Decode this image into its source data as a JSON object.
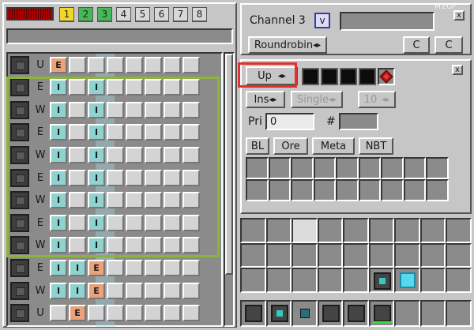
{
  "channels": [
    "1",
    "2",
    "3",
    "4",
    "5",
    "6",
    "7",
    "8"
  ],
  "channel_panel": {
    "label": "Channel 3",
    "checkbox_mark": "v",
    "name_value": "",
    "close": "x",
    "mode_button": "Roundrobin",
    "mode_arrow": "◂▸",
    "c_button_1": "C",
    "c_button_2": "C"
  },
  "settings_panel": {
    "close": "x",
    "direction_button": "Up",
    "ins_button": "Ins",
    "single_button": "Single",
    "count_button": "10",
    "arrow": "◂▸",
    "pri_label": "Pri",
    "pri_value": "0",
    "hash_label": "#",
    "hash_value": "",
    "filters": [
      "BL",
      "Ore",
      "Meta",
      "NBT"
    ]
  },
  "connections": [
    {
      "side": "U",
      "cells": [
        "E",
        "",
        "",
        "",
        "",
        "",
        "",
        ""
      ]
    },
    {
      "side": "E",
      "cells": [
        "I",
        "",
        "I",
        "",
        "",
        "",
        "",
        ""
      ]
    },
    {
      "side": "W",
      "cells": [
        "I",
        "",
        "I",
        "",
        "",
        "",
        "",
        ""
      ]
    },
    {
      "side": "E",
      "cells": [
        "I",
        "",
        "I",
        "",
        "",
        "",
        "",
        ""
      ]
    },
    {
      "side": "W",
      "cells": [
        "I",
        "",
        "I",
        "",
        "",
        "",
        "",
        ""
      ]
    },
    {
      "side": "E",
      "cells": [
        "I",
        "",
        "I",
        "",
        "",
        "",
        "",
        ""
      ]
    },
    {
      "side": "W",
      "cells": [
        "I",
        "",
        "I",
        "",
        "",
        "",
        "",
        ""
      ]
    },
    {
      "side": "E",
      "cells": [
        "I",
        "",
        "I",
        "",
        "",
        "",
        "",
        ""
      ]
    },
    {
      "side": "W",
      "cells": [
        "I",
        "",
        "I",
        "",
        "",
        "",
        "",
        ""
      ]
    },
    {
      "side": "E",
      "cells": [
        "I",
        "I",
        "E",
        "",
        "",
        "",
        "",
        ""
      ]
    },
    {
      "side": "W",
      "cells": [
        "I",
        "I",
        "E",
        "",
        "",
        "",
        "",
        ""
      ]
    },
    {
      "side": "U",
      "cells": [
        "",
        "E",
        "",
        "",
        "",
        "",
        "",
        ""
      ]
    }
  ],
  "watermark": "M EGF",
  "colors": {
    "input": "#8fd3d0",
    "extract": "#e9a27a",
    "selection": "#8db43b",
    "highlight": "#e03030"
  }
}
